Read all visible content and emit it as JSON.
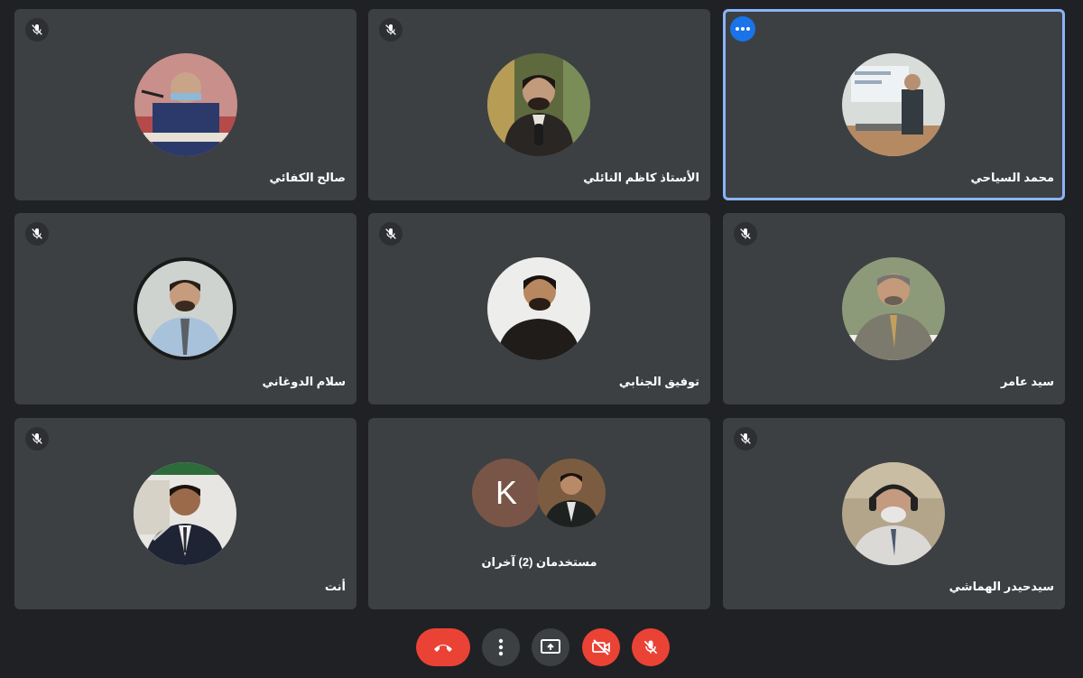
{
  "participants": [
    {
      "name": "محمد السياحي",
      "muted": false,
      "active": true
    },
    {
      "name": "الأستاذ كاظم النائلي",
      "muted": true,
      "active": false
    },
    {
      "name": "صالح الكفائي",
      "muted": true,
      "active": false
    },
    {
      "name": "سيد عامر",
      "muted": true,
      "active": false
    },
    {
      "name": "توفيق الجنابي",
      "muted": true,
      "active": false
    },
    {
      "name": "سلام الدوغاني",
      "muted": true,
      "active": false
    },
    {
      "name": "سيدحيدر الهماشي",
      "muted": true,
      "active": false
    },
    {
      "name": "مستخدمان (2) آخران",
      "muted": false,
      "active": false,
      "initial": "K"
    },
    {
      "name": "أنت",
      "muted": true,
      "active": false
    }
  ],
  "controls": [
    {
      "icon": "hang-up-icon",
      "color": "#ea4335"
    },
    {
      "icon": "more-options-icon",
      "color": "#3c4043"
    },
    {
      "icon": "present-screen-icon",
      "color": "#3c4043"
    },
    {
      "icon": "camera-off-icon",
      "color": "#ea4335"
    },
    {
      "icon": "mic-off-icon",
      "color": "#ea4335"
    }
  ],
  "colors": {
    "background": "#202124",
    "tile": "#3c4043",
    "active_border": "#8ab4f8",
    "accent_blue": "#1a73e8",
    "danger_red": "#ea4335",
    "k_avatar": "#795548"
  }
}
